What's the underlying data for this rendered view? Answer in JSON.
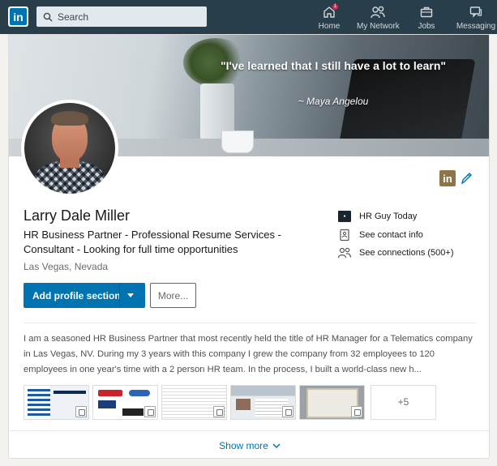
{
  "nav": {
    "logo": "in",
    "search_placeholder": "Search",
    "items": [
      {
        "label": "Home",
        "badge": "1"
      },
      {
        "label": "My Network"
      },
      {
        "label": "Jobs"
      },
      {
        "label": "Messaging"
      }
    ]
  },
  "banner": {
    "quote": "\"I've learned that I still have a lot to learn\"",
    "author": "~ Maya Angelou"
  },
  "profile": {
    "badge": "in",
    "name": "Larry Dale Miller",
    "headline": "HR Business Partner - Professional Resume Services - Consultant - Looking for full time opportunities",
    "location": "Las Vegas, Nevada",
    "add_section_label": "Add profile section",
    "more_label": "More..."
  },
  "sidebar": {
    "company": "HR Guy Today",
    "contact": "See contact info",
    "connections": "See connections (500+)"
  },
  "summary": {
    "text": "I am a seasoned HR Business Partner that most recently held the title of HR Manager for a Telematics company in Las Vegas, NV. During my 3 years with this company I grew the company from 32 employees to 120 employees in one year's time with a 2 person HR team. In the process, I built a world-class new h..."
  },
  "media": {
    "more_count": "+5"
  },
  "footer": {
    "show_more": "Show more"
  },
  "colors": {
    "nav_bg": "#283e4a",
    "primary": "#0073b1",
    "badge_gold": "#8d7547"
  }
}
